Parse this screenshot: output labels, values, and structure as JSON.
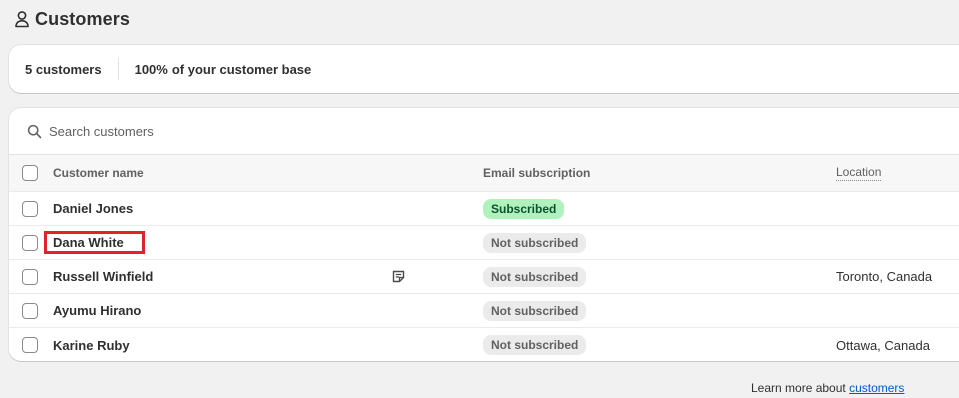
{
  "page": {
    "title": "Customers",
    "title_icon": "person-icon"
  },
  "stats": {
    "count_label": "5 customers",
    "base_percent": "100%",
    "base_label": " of your customer base"
  },
  "search": {
    "placeholder": "Search customers",
    "value": ""
  },
  "table": {
    "columns": {
      "name": "Customer name",
      "email": "Email subscription",
      "location": "Location"
    },
    "rows": [
      {
        "name": "Daniel Jones",
        "email_status": "Subscribed",
        "location": "",
        "has_note": false
      },
      {
        "name": "Dana White",
        "email_status": "Not subscribed",
        "location": "",
        "has_note": false,
        "highlighted": true
      },
      {
        "name": "Russell Winfield",
        "email_status": "Not subscribed",
        "location": "Toronto, Canada",
        "has_note": true
      },
      {
        "name": "Ayumu Hirano",
        "email_status": "Not subscribed",
        "location": "",
        "has_note": false
      },
      {
        "name": "Karine Ruby",
        "email_status": "Not subscribed",
        "location": "Ottawa, Canada",
        "has_note": false
      }
    ]
  },
  "footer": {
    "text": "Learn more about ",
    "link": "customers"
  },
  "colors": {
    "subscribed_bg": "#aff2bb",
    "not_subscribed_bg": "#ebebeb",
    "highlight_border": "#e2222b",
    "link": "#005bd3"
  }
}
